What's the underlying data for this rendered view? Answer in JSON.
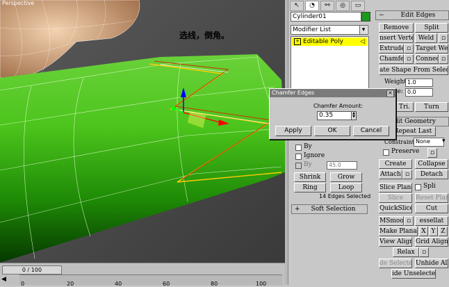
{
  "viewport": {
    "label": "Perspective",
    "note": "选线，倒角。"
  },
  "timeline": {
    "slider": "0 / 100",
    "ticks": [
      "0",
      "20",
      "40",
      "60",
      "80",
      "100"
    ]
  },
  "command_panel": {
    "tabs": [
      "create-icon",
      "modify-icon",
      "hierarchy-icon",
      "motion-icon",
      "display-icon",
      "utilities-icon"
    ],
    "object_name": "Cylinder01",
    "object_color": "#1a9a1a",
    "modifier_list": "Modifier List",
    "stack_item": "Editable Poly"
  },
  "left_selection": {
    "by_vertex": "By",
    "ignore": "Ignore",
    "by_angle": "By",
    "angle_value": "45.0",
    "shrink": "Shrink",
    "grow": "Grow",
    "ring": "Ring",
    "loop": "Loop",
    "status": "14 Edges Selected",
    "soft_selection": "Soft Selection"
  },
  "edit_edges": {
    "title": "Edit Edges",
    "remove": "Remove",
    "split": "Split",
    "insert_vertex": "nsert Verte",
    "weld": "Weld",
    "extrude": "Extrude",
    "target_weld": "Target Weld",
    "chamfer": "Chamfer",
    "connect": "Connect",
    "create_shape": "ate Shape From Select",
    "weight_label": "Weight:",
    "weight_value": "1.0",
    "crease_label": "se:",
    "crease_value": "0.0",
    "edit_tri": "Tri.",
    "turn": "Turn"
  },
  "edit_geometry": {
    "title": "dit Geometry",
    "repeat_last": "Repeat Last",
    "constraints_label": "Constraints:",
    "constraints_value": "None",
    "preserve": "Preserve",
    "create": "Create",
    "collapse": "Collapse",
    "attach": "Attach",
    "detach": "Detach",
    "slice_plane": "Slice Plane",
    "split": "Spli",
    "slice": "Slice",
    "reset_plane": "Reset Plane",
    "quickslice": "QuickSlice",
    "cut": "Cut",
    "msmooth": "MSmooth",
    "tessellate": "essellat",
    "make_planar": "Make Planar",
    "x": "X",
    "y": "Y",
    "z": "Z",
    "view_align": "View Align",
    "grid_align": "Grid Align",
    "relax": "Relax",
    "hide_selected": "de Selecte",
    "unhide_all": "Unhide All",
    "hide_unselected": "ide Unselecte"
  },
  "dialog": {
    "title": "Chamfer Edges",
    "amount_label": "Chamfer Amount:",
    "amount_value": "0.35",
    "apply": "Apply",
    "ok": "OK",
    "cancel": "Cancel"
  }
}
